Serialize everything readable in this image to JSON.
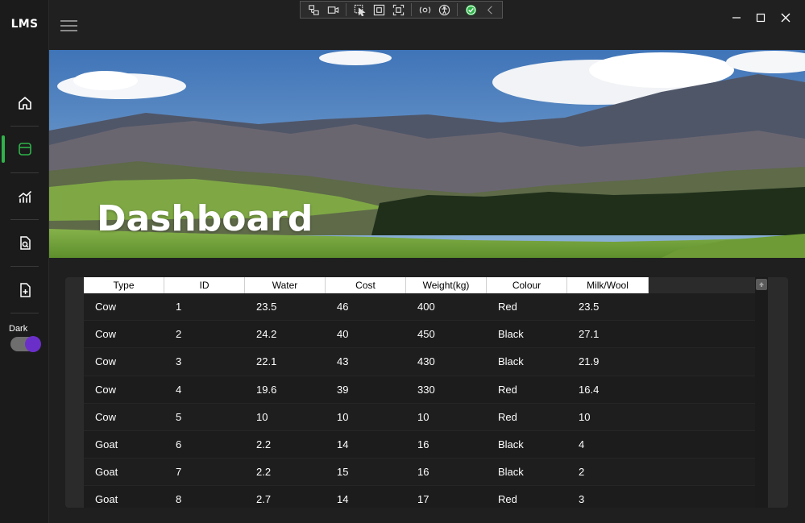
{
  "app": {
    "logo": "LMS"
  },
  "sidebar": {
    "items": [
      {
        "name": "home",
        "icon": "home-icon"
      },
      {
        "name": "dashboard",
        "icon": "dashboard-icon",
        "active": true
      },
      {
        "name": "analytics",
        "icon": "analytics-icon"
      },
      {
        "name": "search-document",
        "icon": "document-search-icon"
      },
      {
        "name": "add-document",
        "icon": "document-add-icon"
      }
    ],
    "theme_toggle": {
      "label": "Dark",
      "on": true
    },
    "active_color": "#2fb34a",
    "toggle_color": "#6b2fc9"
  },
  "hero": {
    "title": "Dashboard"
  },
  "table": {
    "columns": [
      "Type",
      "ID",
      "Water",
      "Cost",
      "Weight(kg)",
      "Colour",
      "Milk/Wool"
    ],
    "rows": [
      [
        "Cow",
        "1",
        "23.5",
        "46",
        "400",
        "Red",
        "23.5"
      ],
      [
        "Cow",
        "2",
        "24.2",
        "40",
        "450",
        "Black",
        "27.1"
      ],
      [
        "Cow",
        "3",
        "22.1",
        "43",
        "430",
        "Black",
        "21.9"
      ],
      [
        "Cow",
        "4",
        "19.6",
        "39",
        "330",
        "Red",
        "16.4"
      ],
      [
        "Cow",
        "5",
        "10",
        "10",
        "10",
        "Red",
        "10"
      ],
      [
        "Goat",
        "6",
        "2.2",
        "14",
        "16",
        "Black",
        "4"
      ],
      [
        "Goat",
        "7",
        "2.2",
        "15",
        "16",
        "Black",
        "2"
      ],
      [
        "Goat",
        "8",
        "2.7",
        "14",
        "17",
        "Red",
        "3"
      ]
    ]
  }
}
